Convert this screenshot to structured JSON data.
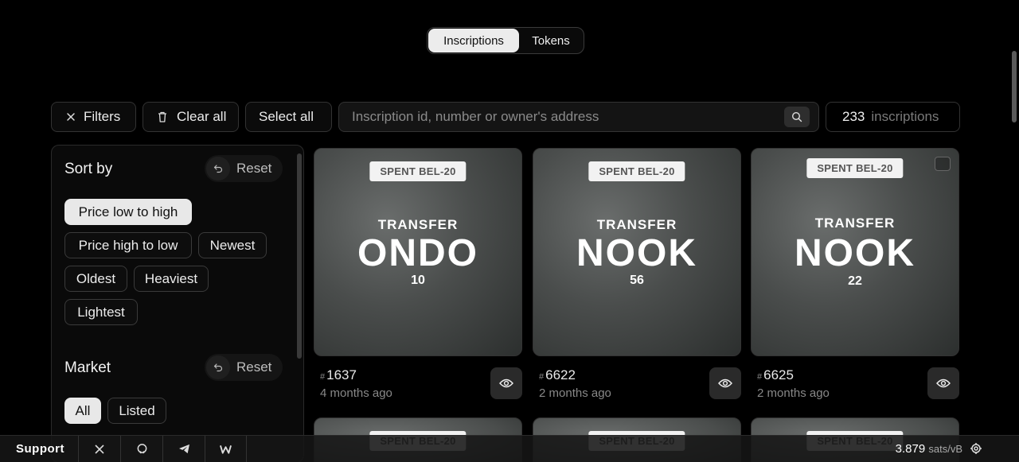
{
  "tabs": [
    {
      "label": "Inscriptions",
      "active": true
    },
    {
      "label": "Tokens",
      "active": false
    }
  ],
  "toolbar": {
    "filters_label": "Filters",
    "clear_label": "Clear all",
    "select_all_label": "Select all",
    "search_placeholder": "Inscription id, number or owner's address",
    "count_value": "233",
    "count_label": "inscriptions"
  },
  "sidebar": {
    "sort": {
      "title": "Sort by",
      "reset_label": "Reset",
      "options": [
        "Price low to high",
        "Price high to low",
        "Newest",
        "Oldest",
        "Heaviest",
        "Lightest"
      ],
      "selected": "Price low to high"
    },
    "market": {
      "title": "Market",
      "reset_label": "Reset",
      "options": [
        "All",
        "Listed"
      ],
      "selected": "All"
    }
  },
  "cards": [
    {
      "tag": "SPENT BEL-20",
      "op": "TRANSFER",
      "ticker": "ONDO",
      "amount": "10",
      "hash": "#",
      "number": "1637",
      "age": "4 months ago",
      "checkbox": false
    },
    {
      "tag": "SPENT BEL-20",
      "op": "TRANSFER",
      "ticker": "NOOK",
      "amount": "56",
      "hash": "#",
      "number": "6622",
      "age": "2 months ago",
      "checkbox": false
    },
    {
      "tag": "SPENT BEL-20",
      "op": "TRANSFER",
      "ticker": "NOOK",
      "amount": "22",
      "hash": "#",
      "number": "6625",
      "age": "2 months ago",
      "checkbox": true
    }
  ],
  "footer": {
    "support_label": "Support",
    "icons": [
      "x-icon",
      "github-icon",
      "telegram-icon",
      "w-icon"
    ],
    "fee_value": "3.879",
    "fee_unit": "sats/vB"
  },
  "colors": {
    "background": "#000000",
    "selected_chip": "#e8e8e8",
    "card_art": "#4a4d4c"
  }
}
